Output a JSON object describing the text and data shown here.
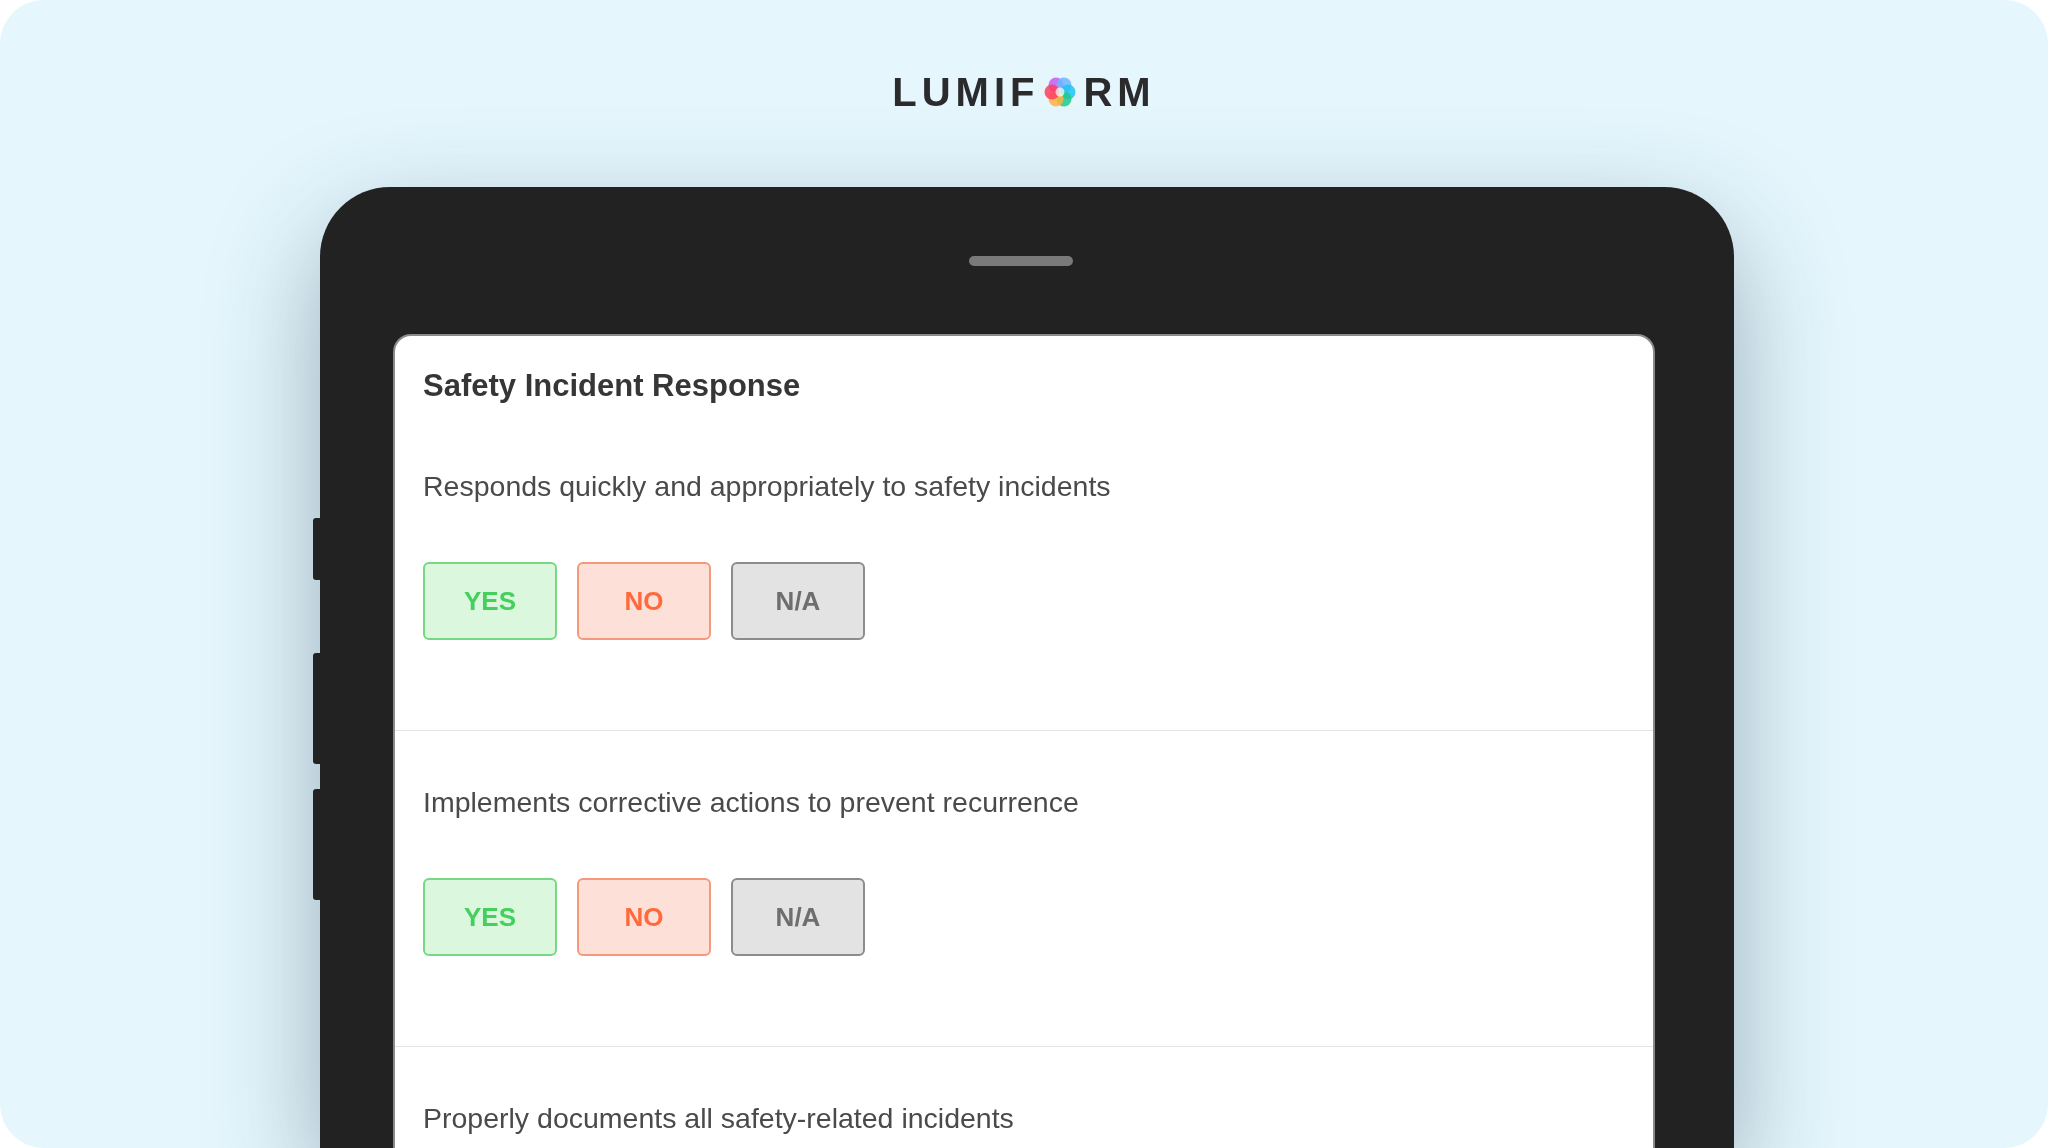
{
  "logo": {
    "text_before_mark": "LUMIF",
    "text_after_mark": "RM"
  },
  "form": {
    "title": "Safety Incident Response",
    "questions": [
      {
        "text": "Responds quickly and appropriately to safety incidents",
        "options": [
          {
            "label": "YES",
            "kind": "yes"
          },
          {
            "label": "NO",
            "kind": "no"
          },
          {
            "label": "N/A",
            "kind": "na"
          }
        ]
      },
      {
        "text": "Implements corrective actions to prevent recurrence",
        "options": [
          {
            "label": "YES",
            "kind": "yes"
          },
          {
            "label": "NO",
            "kind": "no"
          },
          {
            "label": "N/A",
            "kind": "na"
          }
        ]
      },
      {
        "text": "Properly documents all safety-related incidents"
      }
    ]
  }
}
